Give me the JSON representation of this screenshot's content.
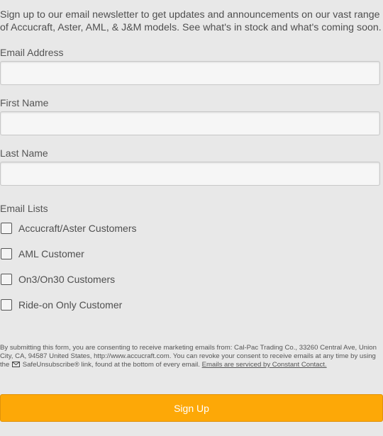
{
  "intro": {
    "text": "Sign up to our email newsletter to get updates and announcements on our vast range of Accucraft, Aster, AML, & J&M models. See what's in stock and what's coming soon."
  },
  "fields": {
    "email_label": "Email Address",
    "email_value": "",
    "first_name_label": "First Name",
    "first_name_value": "",
    "last_name_label": "Last Name",
    "last_name_value": ""
  },
  "lists": {
    "heading": "Email Lists",
    "items": [
      {
        "label": "Accucraft/Aster Customers",
        "checked": false
      },
      {
        "label": "AML Customer",
        "checked": false
      },
      {
        "label": "On3/On30 Customers",
        "checked": false
      },
      {
        "label": "Ride-on Only Customer",
        "checked": false
      }
    ]
  },
  "consent": {
    "text_before_icon": "By submitting this form, you are consenting to receive marketing emails from: Cal-Pac Trading Co., 33260 Central Ave, Union City, CA, 94587 United States, http://www.accucraft.com. You can revoke your consent to receive emails at any time by using the",
    "icon": "envelope-icon",
    "text_after_icon": "SafeUnsubscribe® link, found at the bottom of every email.",
    "link_text": "Emails are serviced by Constant Contact."
  },
  "submit": {
    "label": "Sign Up",
    "color": "#fda807"
  }
}
